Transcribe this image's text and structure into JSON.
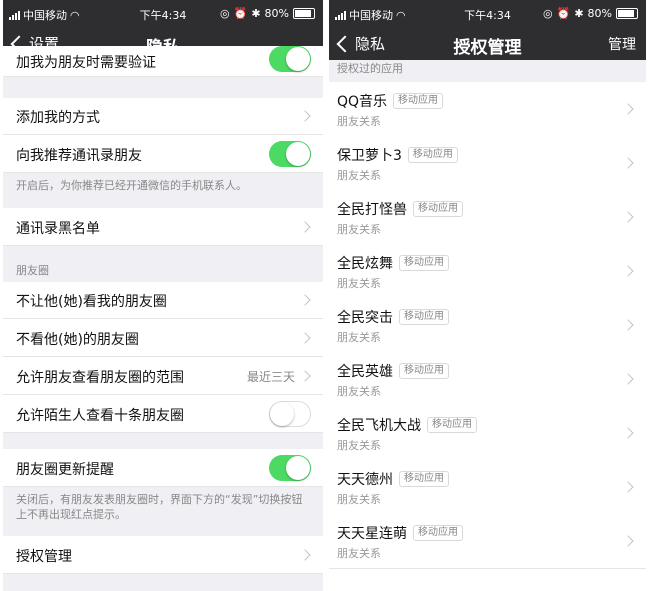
{
  "status_bar": {
    "carrier": "中国移动",
    "time": "下午4:34",
    "battery": "80%"
  },
  "left": {
    "back_label": "设置",
    "title": "隐私",
    "verify_row": "加我为朋友时需要验证",
    "add_me_row": "添加我的方式",
    "recommend_row": "向我推荐通讯录朋友",
    "recommend_note": "开启后，为你推荐已经开通微信的手机联系人。",
    "blacklist_row": "通讯录黑名单",
    "moments_header": "朋友圈",
    "hide_from_row": "不让他(她)看我的朋友圈",
    "not_see_row": "不看他(她)的朋友圈",
    "range_row": "允许朋友查看朋友圈的范围",
    "range_value": "最近三天",
    "stranger_row": "允许陌生人查看十条朋友圈",
    "update_reminder_row": "朋友圈更新提醒",
    "update_note": "关闭后，有朋友发表朋友圈时，界面下方的“发现”切换按钮上不再出现红点提示。",
    "auth_row": "授权管理",
    "toggles": {
      "verify": true,
      "recommend": true,
      "stranger": false,
      "update": true
    }
  },
  "right": {
    "back_label": "隐私",
    "title": "授权管理",
    "manage_label": "管理",
    "section_header": "授权过的应用",
    "apps": [
      {
        "name": "QQ音乐",
        "tag": "移动应用",
        "scope": "朋友关系"
      },
      {
        "name": "保卫萝卜3",
        "tag": "移动应用",
        "scope": "朋友关系"
      },
      {
        "name": "全民打怪兽",
        "tag": "移动应用",
        "scope": "朋友关系"
      },
      {
        "name": "全民炫舞",
        "tag": "移动应用",
        "scope": "朋友关系"
      },
      {
        "name": "全民突击",
        "tag": "移动应用",
        "scope": "朋友关系"
      },
      {
        "name": "全民英雄",
        "tag": "移动应用",
        "scope": "朋友关系"
      },
      {
        "name": "全民飞机大战",
        "tag": "移动应用",
        "scope": "朋友关系"
      },
      {
        "name": "天天德州",
        "tag": "移动应用",
        "scope": "朋友关系"
      },
      {
        "name": "天天星连萌",
        "tag": "移动应用",
        "scope": "朋友关系"
      }
    ]
  },
  "colors": {
    "navbar": "#2e2e31",
    "toggle_on": "#4cd964",
    "group_bg": "#efeff4"
  }
}
